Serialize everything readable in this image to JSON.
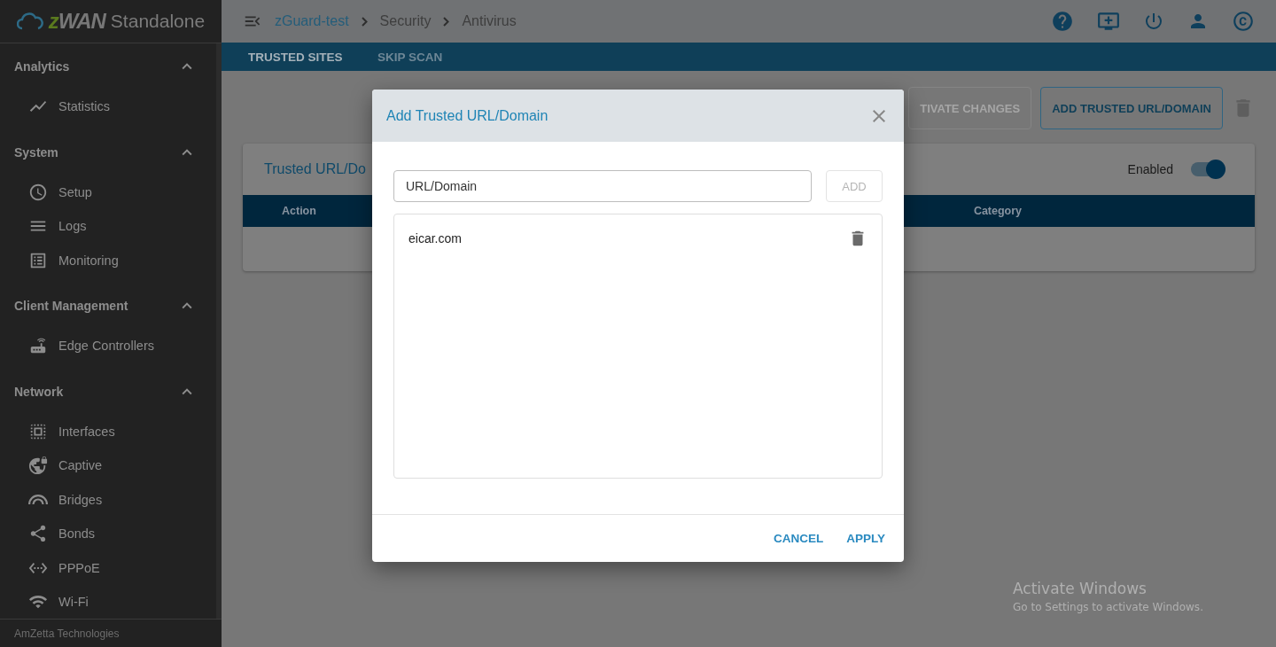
{
  "logo": {
    "brand": "zWAN",
    "product": "Standalone"
  },
  "sidebar": {
    "sections": [
      {
        "title": "Analytics",
        "expanded": true,
        "items": [
          "Statistics"
        ]
      },
      {
        "title": "System",
        "expanded": true,
        "items": [
          "Setup",
          "Logs",
          "Monitoring"
        ]
      },
      {
        "title": "Client Management",
        "expanded": true,
        "items": [
          "Edge Controllers"
        ]
      },
      {
        "title": "Network",
        "expanded": true,
        "items": [
          "Interfaces",
          "Captive",
          "Bridges",
          "Bonds",
          "PPPoE",
          "Wi-Fi"
        ]
      }
    ],
    "footer": "AmZetta Technologies"
  },
  "breadcrumb": [
    {
      "label": "zGuard-test",
      "link": true
    },
    {
      "label": "Security",
      "link": false
    },
    {
      "label": "Antivirus",
      "link": false
    }
  ],
  "tabs": [
    {
      "label": "TRUSTED SITES",
      "selected": true
    },
    {
      "label": "SKIP SCAN",
      "selected": false
    }
  ],
  "toolbar": {
    "buttons": [
      {
        "label": "TIVATE CHANGES",
        "disabled": true
      },
      {
        "label": "ADD TRUSTED URL/DOMAIN",
        "disabled": false
      }
    ]
  },
  "card": {
    "title": "Trusted URL/Do",
    "toggle_label": "Enabled",
    "enabled": true,
    "columns": [
      "Action",
      "Category"
    ]
  },
  "dialog": {
    "title": "Add Trusted URL/Domain",
    "field": {
      "value": "URL/Domain"
    },
    "add_button": {
      "label": "ADD",
      "disabled": true
    },
    "entries": [
      "eicar.com"
    ],
    "buttons": [
      "CANCEL",
      "APPLY"
    ]
  },
  "os_notice": {
    "title": "Activate Windows",
    "text": "Go to Settings to activate Windows."
  }
}
